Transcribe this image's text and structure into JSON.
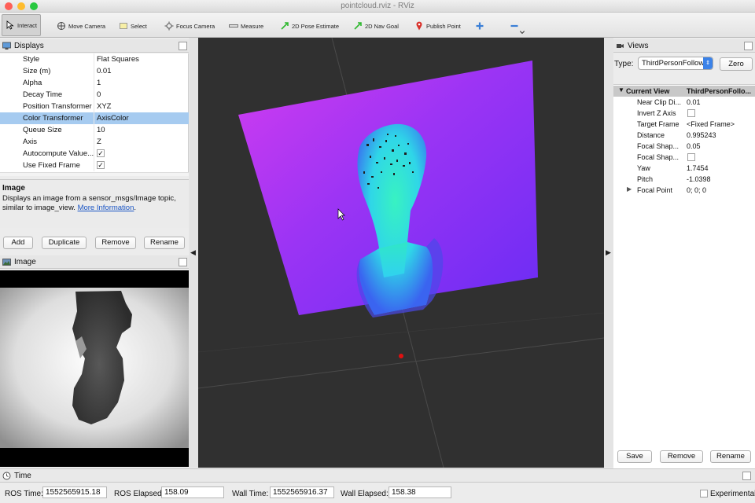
{
  "window": {
    "title": "pointcloud.rviz - RViz",
    "light_colors": [
      "#fe5f57",
      "#febc2e",
      "#28c840"
    ]
  },
  "toolbar": {
    "interact": "Interact",
    "move_camera": "Move Camera",
    "select": "Select",
    "focus_camera": "Focus Camera",
    "measure": "Measure",
    "pose_estimate": "2D Pose Estimate",
    "nav_goal": "2D Nav Goal",
    "publish_point": "Publish Point"
  },
  "displays": {
    "title": "Displays",
    "properties": [
      {
        "name": "Style",
        "value": "Flat Squares"
      },
      {
        "name": "Size (m)",
        "value": "0.01"
      },
      {
        "name": "Alpha",
        "value": "1"
      },
      {
        "name": "Decay Time",
        "value": "0"
      },
      {
        "name": "Position Transformer",
        "value": "XYZ"
      },
      {
        "name": "Color Transformer",
        "value": "AxisColor",
        "selected": true
      },
      {
        "name": "Queue Size",
        "value": "10"
      },
      {
        "name": "Axis",
        "value": "Z"
      },
      {
        "name": "Autocompute Value...",
        "value": "✓"
      },
      {
        "name": "Use Fixed Frame",
        "value": "✓"
      }
    ],
    "description": {
      "title": "Image",
      "text": "Displays an image from a sensor_msgs/Image topic, similar to image_view.",
      "link": "More Information",
      "suffix": "."
    },
    "buttons": {
      "add": "Add",
      "duplicate": "Duplicate",
      "remove": "Remove",
      "rename": "Rename"
    }
  },
  "image_panel": {
    "title": "Image"
  },
  "views": {
    "title": "Views",
    "type_label": "Type:",
    "type_value": "ThirdPersonFollow",
    "zero_button": "Zero",
    "current_view": {
      "name": "Current View",
      "value": "ThirdPersonFollo..."
    },
    "properties": [
      {
        "name": "Near Clip Di...",
        "value": "0.01"
      },
      {
        "name": "Invert Z Axis",
        "value": ""
      },
      {
        "name": "Target Frame",
        "value": "<Fixed Frame>"
      },
      {
        "name": "Distance",
        "value": "0.995243"
      },
      {
        "name": "Focal Shap...",
        "value": "0.05"
      },
      {
        "name": "Focal Shap...",
        "value": ""
      },
      {
        "name": "Yaw",
        "value": "1.7454"
      },
      {
        "name": "Pitch",
        "value": "-1.0398"
      },
      {
        "name": "Focal Point",
        "value": "0; 0; 0"
      }
    ],
    "buttons": {
      "save": "Save",
      "remove": "Remove",
      "rename": "Rename"
    }
  },
  "time": {
    "title": "Time",
    "ros_time_label": "ROS Time:",
    "ros_time": "1552565915.18",
    "ros_elapsed_label": "ROS Elapsed:",
    "ros_elapsed": "158.09",
    "wall_time_label": "Wall Time:",
    "wall_time": "1552565916.37",
    "wall_elapsed_label": "Wall Elapsed:",
    "wall_elapsed": "158.38",
    "experimental_label": "Experimental"
  }
}
